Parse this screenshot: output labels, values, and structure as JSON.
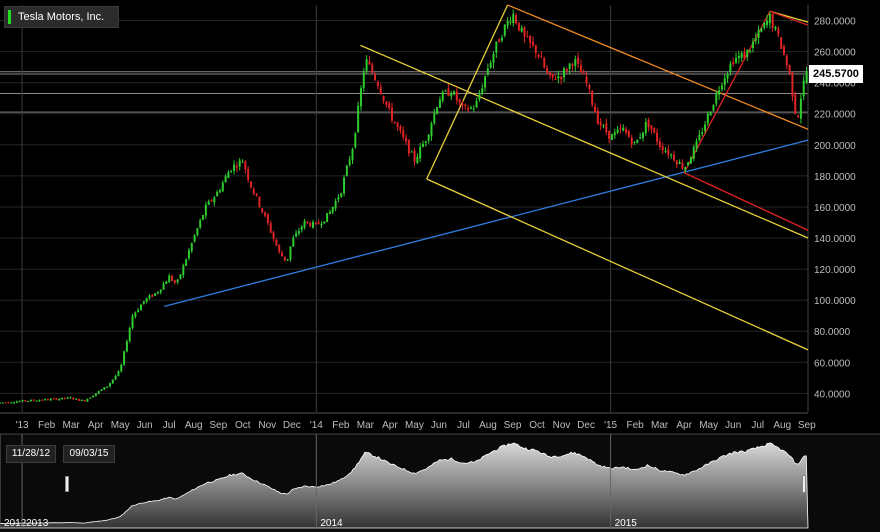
{
  "chart_data": {
    "type": "candlestick",
    "series_name": "Tesla Motors, Inc.",
    "last_price": "245.5700",
    "y_ticks": [
      "40.0000",
      "60.0000",
      "80.0000",
      "100.0000",
      "120.0000",
      "140.0000",
      "160.0000",
      "180.0000",
      "200.0000",
      "220.0000",
      "240.0000",
      "260.0000",
      "280.0000"
    ],
    "ylim": [
      28,
      290
    ],
    "x_month_labels": [
      {
        "label": "'13",
        "t": 0
      },
      {
        "label": "Feb",
        "t": 1
      },
      {
        "label": "Mar",
        "t": 2
      },
      {
        "label": "Apr",
        "t": 3
      },
      {
        "label": "May",
        "t": 4
      },
      {
        "label": "Jun",
        "t": 5
      },
      {
        "label": "Jul",
        "t": 6
      },
      {
        "label": "Aug",
        "t": 7
      },
      {
        "label": "Sep",
        "t": 8
      },
      {
        "label": "Oct",
        "t": 9
      },
      {
        "label": "Nov",
        "t": 10
      },
      {
        "label": "Dec",
        "t": 11
      },
      {
        "label": "'14",
        "t": 12
      },
      {
        "label": "Feb",
        "t": 13
      },
      {
        "label": "Mar",
        "t": 14
      },
      {
        "label": "Apr",
        "t": 15
      },
      {
        "label": "May",
        "t": 16
      },
      {
        "label": "Jun",
        "t": 17
      },
      {
        "label": "Jul",
        "t": 18
      },
      {
        "label": "Aug",
        "t": 19
      },
      {
        "label": "Sep",
        "t": 20
      },
      {
        "label": "Oct",
        "t": 21
      },
      {
        "label": "Nov",
        "t": 22
      },
      {
        "label": "Dec",
        "t": 23
      },
      {
        "label": "'15",
        "t": 24
      },
      {
        "label": "Feb",
        "t": 25
      },
      {
        "label": "Mar",
        "t": 26
      },
      {
        "label": "Apr",
        "t": 27
      },
      {
        "label": "May",
        "t": 28
      },
      {
        "label": "Jun",
        "t": 29
      },
      {
        "label": "Jul",
        "t": 30
      },
      {
        "label": "Aug",
        "t": 31
      },
      {
        "label": "Sep",
        "t": 32
      }
    ],
    "xlim": [
      -0.9,
      32.05
    ],
    "year_grid_t": [
      0,
      12,
      24
    ],
    "price_path": [
      [
        -0.9,
        34
      ],
      [
        0,
        35
      ],
      [
        1,
        36
      ],
      [
        2,
        37
      ],
      [
        2.5,
        35
      ],
      [
        3,
        40
      ],
      [
        3.5,
        45
      ],
      [
        4,
        55
      ],
      [
        4.5,
        90
      ],
      [
        5,
        100
      ],
      [
        5.5,
        105
      ],
      [
        6,
        115
      ],
      [
        6.3,
        110
      ],
      [
        7,
        140
      ],
      [
        7.5,
        160
      ],
      [
        8,
        170
      ],
      [
        8.5,
        185
      ],
      [
        9,
        190
      ],
      [
        9.3,
        175
      ],
      [
        10,
        150
      ],
      [
        10.5,
        130
      ],
      [
        10.8,
        125
      ],
      [
        11,
        138
      ],
      [
        11.5,
        150
      ],
      [
        12,
        148
      ],
      [
        12.5,
        155
      ],
      [
        13,
        170
      ],
      [
        13.5,
        200
      ],
      [
        14,
        255
      ],
      [
        14.5,
        240
      ],
      [
        15,
        220
      ],
      [
        15.5,
        205
      ],
      [
        16,
        190
      ],
      [
        16.5,
        205
      ],
      [
        17,
        230
      ],
      [
        17.5,
        235
      ],
      [
        18,
        222
      ],
      [
        18.5,
        225
      ],
      [
        19,
        250
      ],
      [
        19.5,
        270
      ],
      [
        20,
        285
      ],
      [
        20.5,
        268
      ],
      [
        21,
        260
      ],
      [
        21.5,
        242
      ],
      [
        22,
        245
      ],
      [
        22.5,
        255
      ],
      [
        23,
        240
      ],
      [
        23.5,
        215
      ],
      [
        24,
        205
      ],
      [
        24.5,
        210
      ],
      [
        25,
        200
      ],
      [
        25.5,
        215
      ],
      [
        26,
        200
      ],
      [
        26.5,
        193
      ],
      [
        27,
        185
      ],
      [
        27.5,
        200
      ],
      [
        28,
        220
      ],
      [
        28.5,
        240
      ],
      [
        29,
        255
      ],
      [
        29.5,
        258
      ],
      [
        30,
        270
      ],
      [
        30.5,
        282
      ],
      [
        31,
        262
      ],
      [
        31.3,
        245
      ],
      [
        31.6,
        215
      ],
      [
        31.8,
        235
      ],
      [
        32,
        248
      ]
    ],
    "trendlines": [
      {
        "color": "#2f7de0",
        "p1": [
          5.8,
          96
        ],
        "p2": [
          32.05,
          203
        ]
      },
      {
        "color": "#e8d03a",
        "p1": [
          13.8,
          264
        ],
        "p2": [
          32.05,
          140
        ]
      },
      {
        "color": "#e8d03a",
        "p1": [
          16.5,
          178
        ],
        "p2": [
          32.05,
          68
        ]
      },
      {
        "color": "#e8d03a",
        "p1": [
          16.5,
          178
        ],
        "p2": [
          19.8,
          290
        ]
      },
      {
        "color": "#ee8822",
        "p1": [
          19.8,
          290
        ],
        "p2": [
          32.05,
          210
        ]
      },
      {
        "color": "#e8d03a",
        "p1": [
          30.5,
          286
        ],
        "p2": [
          32.05,
          279
        ]
      },
      {
        "color": "#dd2222",
        "p1": [
          30.5,
          286
        ],
        "p2": [
          32.05,
          277
        ]
      },
      {
        "color": "#dd2222",
        "p1": [
          27,
          182
        ],
        "p2": [
          32.05,
          145
        ]
      },
      {
        "color": "#dd2222",
        "p1": [
          27,
          182
        ],
        "p2": [
          30.5,
          286
        ]
      }
    ],
    "h_lines": [
      233,
      245.57,
      247,
      221
    ],
    "navigator": {
      "labels": [
        {
          "label": "2012",
          "t": -0.9
        },
        {
          "label": "2013",
          "t": 0
        },
        {
          "label": "2014",
          "t": 12
        },
        {
          "label": "2015",
          "t": 24
        }
      ],
      "range_start": "11/28/12",
      "range_end": "09/03/15"
    }
  }
}
